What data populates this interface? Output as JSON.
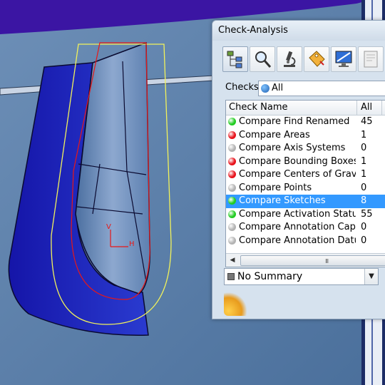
{
  "dialog": {
    "title": "Check-Analysis",
    "toolbar": [
      {
        "icon": "tree-icon"
      },
      {
        "icon": "magnifier-icon"
      },
      {
        "icon": "microscope-icon"
      },
      {
        "icon": "tag-icon"
      },
      {
        "icon": "monitor-icon"
      },
      {
        "icon": "report-icon"
      }
    ],
    "checks": {
      "label": "Checks:",
      "value": "All"
    },
    "list": {
      "columns": [
        "Check Name",
        "All"
      ],
      "rows": [
        {
          "name": "Compare Find Renamed",
          "count": "45",
          "status": "green"
        },
        {
          "name": "Compare Areas",
          "count": "1",
          "status": "red"
        },
        {
          "name": "Compare Axis Systems",
          "count": "0",
          "status": "gray"
        },
        {
          "name": "Compare Bounding Boxes",
          "count": "1",
          "status": "red"
        },
        {
          "name": "Compare Centers of Gravity",
          "count": "1",
          "status": "red"
        },
        {
          "name": "Compare Points",
          "count": "0",
          "status": "gray"
        },
        {
          "name": "Compare Sketches",
          "count": "8",
          "status": "green",
          "selected": true
        },
        {
          "name": "Compare Activation Status",
          "count": "55",
          "status": "green"
        },
        {
          "name": "Compare Annotation Capt…",
          "count": "0",
          "status": "gray"
        },
        {
          "name": "Compare Annotation Datu…",
          "count": "0",
          "status": "gray"
        }
      ],
      "scroll_grip": "III"
    },
    "summary": {
      "value": "No Summary"
    }
  },
  "sketch_axes": {
    "v": "V",
    "h": "H"
  },
  "colors": {
    "green": "#22cc22",
    "red": "#e8121b",
    "gray": "#b3b3b3",
    "selection": "#3399ff"
  }
}
